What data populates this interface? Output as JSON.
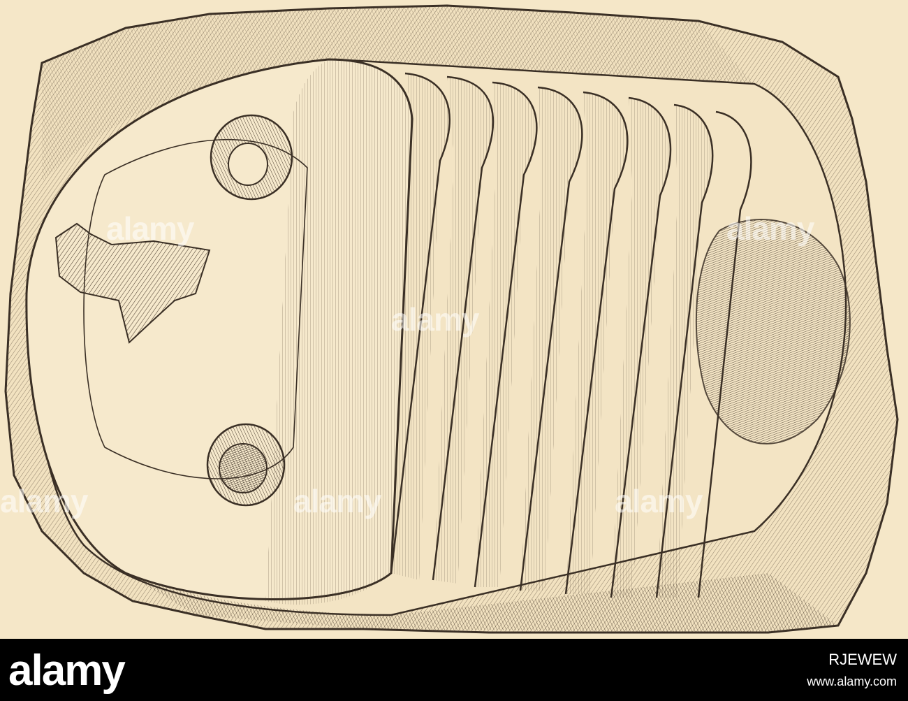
{
  "image": {
    "subject": "trilobite-fossil-engraving",
    "paper_color": "#f5e7c8",
    "ink_color": "#3a2f25"
  },
  "watermarks": {
    "text": "alamy"
  },
  "footer": {
    "brand": "alamy",
    "line": "www.alamy.com",
    "image_id": "RJEWEW"
  }
}
